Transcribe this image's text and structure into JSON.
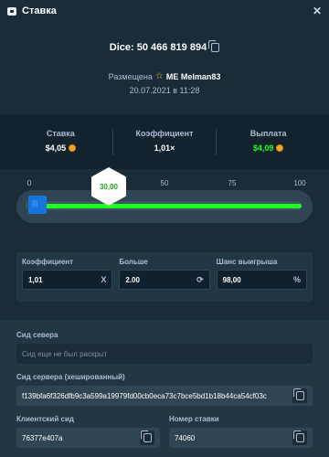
{
  "header": {
    "title": "Ставка"
  },
  "bet": {
    "id_label": "Dice: 50 466 819 894",
    "placed_label": "Размещена",
    "user": "ME Melman83",
    "date": "20.07.2021 в 11:28"
  },
  "stats": {
    "bet_label": "Ставка",
    "bet_value": "$4,05",
    "multiplier_label": "Коэффициент",
    "multiplier_value": "1,01×",
    "payout_label": "Выплата",
    "payout_value": "$4,09"
  },
  "slider": {
    "ticks": [
      "0",
      "25",
      "50",
      "75",
      "100"
    ],
    "result": "30,00",
    "value_percent": 2
  },
  "params": {
    "multiplier_label": "Коэффициент",
    "multiplier_value": "1,01",
    "multiplier_suffix": "X",
    "over_label": "Больше",
    "over_value": "2.00",
    "chance_label": "Шанс выигрыша",
    "chance_value": "98,00",
    "chance_suffix": "%"
  },
  "seeds": {
    "server_label": "Сид севера",
    "server_placeholder": "Сид еще не был раскрыт",
    "hashed_label": "Сид сервера (хешированный)",
    "hashed_value": "f139bfa6f326dfb9c3a599a19979fd00cb0eca73c7bce5bd1b18b44ca54cf03c",
    "client_label": "Клиентский сид",
    "client_value": "76377e407a",
    "nonce_label": "Номер ставки",
    "nonce_value": "74060"
  },
  "colors": {
    "accent_green": "#1fff20",
    "handle_blue": "#1475e1",
    "bg": "#1a2c38"
  }
}
